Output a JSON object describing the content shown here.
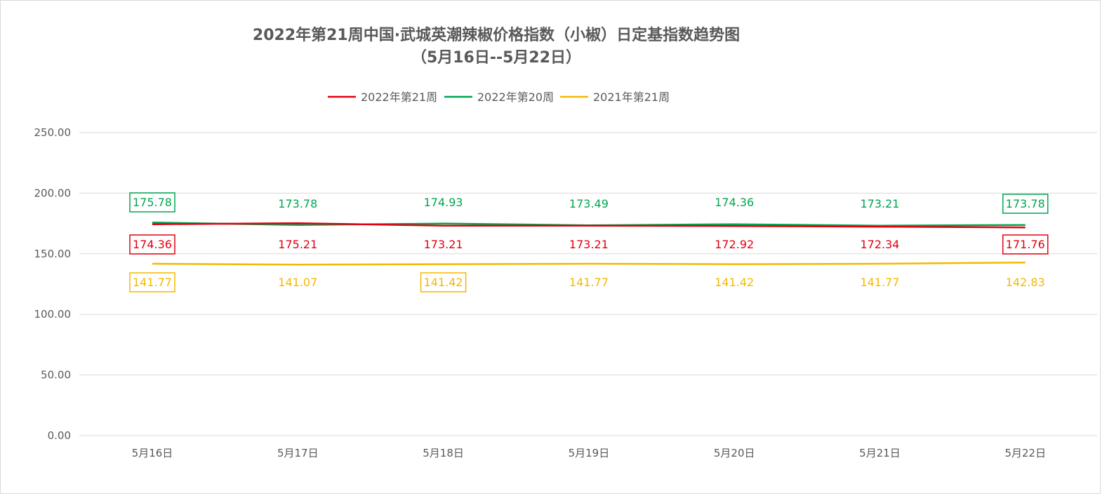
{
  "chart_data": {
    "type": "line",
    "title": "2022年第21周中国·武城英潮辣椒价格指数（小椒）日定基指数趋势图",
    "subtitle": "（5月16日--5月22日）",
    "categories": [
      "5月16日",
      "5月17日",
      "5月18日",
      "5月19日",
      "5月20日",
      "5月21日",
      "5月22日"
    ],
    "ylim": [
      0,
      250
    ],
    "yticks": [
      "0.00",
      "50.00",
      "100.00",
      "150.00",
      "200.00",
      "250.00"
    ],
    "grid": true,
    "legend_position": "top",
    "series": [
      {
        "name": "2022年第21周",
        "color": "#e3000f",
        "values": [
          174.36,
          175.21,
          173.21,
          173.21,
          172.92,
          172.34,
          171.76
        ],
        "labels": [
          "174.36",
          "175.21",
          "173.21",
          "173.21",
          "172.92",
          "172.34",
          "171.76"
        ],
        "boxed": [
          true,
          false,
          false,
          false,
          false,
          false,
          true
        ]
      },
      {
        "name": "2022年第20周",
        "color": "#00a651",
        "values": [
          175.78,
          173.78,
          174.93,
          173.49,
          174.36,
          173.21,
          173.78
        ],
        "labels": [
          "175.78",
          "173.78",
          "174.93",
          "173.49",
          "174.36",
          "173.21",
          "173.78"
        ],
        "boxed": [
          true,
          false,
          false,
          false,
          false,
          false,
          true
        ]
      },
      {
        "name": "2021年第21周",
        "color": "#f5b800",
        "values": [
          141.77,
          141.07,
          141.42,
          141.77,
          141.42,
          141.77,
          142.83
        ],
        "labels": [
          "141.77",
          "141.07",
          "141.42",
          "141.77",
          "141.42",
          "141.77",
          "142.83"
        ],
        "boxed": [
          true,
          false,
          true,
          false,
          false,
          false,
          false
        ]
      }
    ]
  }
}
